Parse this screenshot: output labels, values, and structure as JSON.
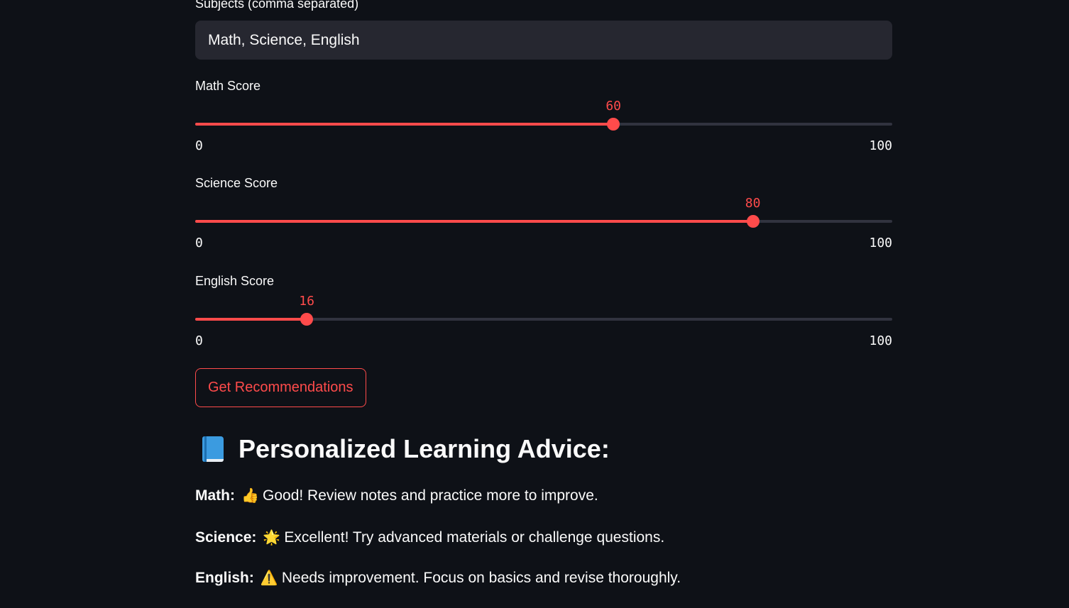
{
  "subjects_field": {
    "label": "Subjects (comma separated)",
    "value": "Math, Science, English"
  },
  "sliders": [
    {
      "label": "Math Score",
      "value": 60,
      "value_text": "60",
      "min": "0",
      "max": "100"
    },
    {
      "label": "Science Score",
      "value": 80,
      "value_text": "80",
      "min": "0",
      "max": "100"
    },
    {
      "label": "English Score",
      "value": 16,
      "value_text": "16",
      "min": "0",
      "max": "100"
    }
  ],
  "button": {
    "label": "Get Recommendations"
  },
  "results": {
    "heading": "Personalized Learning Advice:",
    "heading_icon": "blue-book-icon",
    "items": [
      {
        "subject": "Math:",
        "icon": "thumbs-up-icon",
        "glyph": "👍",
        "text": "Good! Review notes and practice more to improve."
      },
      {
        "subject": "Science:",
        "icon": "sun-icon",
        "glyph": "🌟",
        "text": "Excellent! Try advanced materials or challenge questions."
      },
      {
        "subject": "English:",
        "icon": "warning-icon",
        "glyph": "⚠️",
        "text": "Needs improvement. Focus on basics and revise thoroughly."
      }
    ]
  },
  "colors": {
    "background": "#0e1117",
    "input_background": "#262730",
    "accent": "#ff4b4b",
    "track": "#31333f",
    "text": "#fafafa"
  }
}
